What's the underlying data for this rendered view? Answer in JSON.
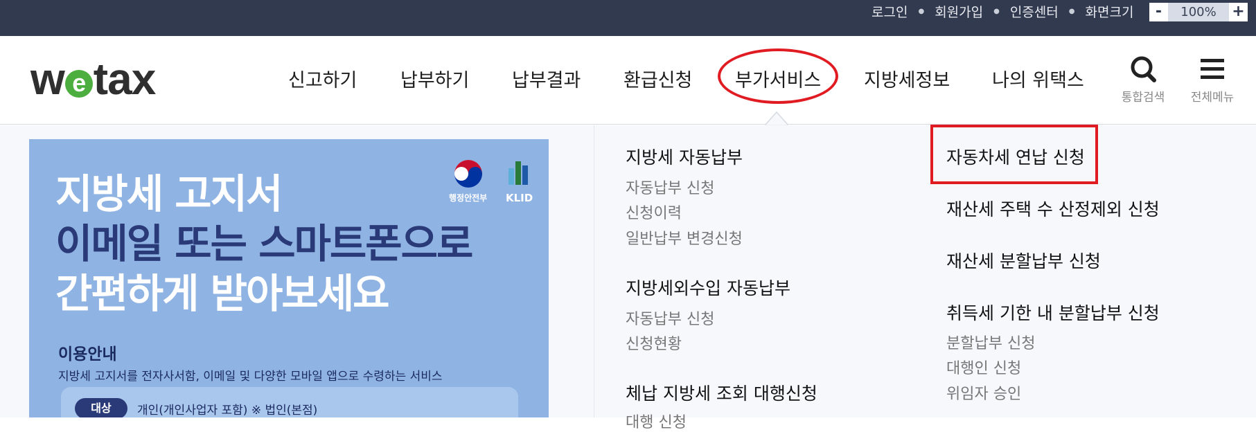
{
  "util_nav": {
    "login": "로그인",
    "join": "회원가입",
    "cert": "인증센터",
    "screen_size": "화면크기",
    "zoom_minus": "-",
    "zoom_value": "100%",
    "zoom_plus": "+"
  },
  "logo": {
    "w": "w",
    "e": "e",
    "tax": "tax"
  },
  "gnb": [
    "신고하기",
    "납부하기",
    "납부결과",
    "환급신청",
    "부가서비스",
    "지방세정보",
    "나의 위택스"
  ],
  "tools": {
    "search": "통합검색",
    "menu": "전체메뉴"
  },
  "banner": {
    "line1": "지방세 고지서",
    "line2a": "이메일 또는 ",
    "line2b": "스마트폰으로",
    "line3a": "간편하게 ",
    "line3b": "받아보세요",
    "org1": "행정안전부",
    "org2": "KLID",
    "label": "이용안내",
    "desc": "지방세 고지서를 전자사서함, 이메일 및 다양한 모바일 앱으로 수령하는 서비스",
    "tag": "대상",
    "tag_text": "개인(개인사업자 포함) ※ 법인(본점)"
  },
  "menu": {
    "col1": {
      "group1_title": "지방세 자동납부",
      "group1_items": [
        "자동납부 신청",
        "신청이력",
        "일반납부 변경신청"
      ],
      "group2_title": "지방세외수입 자동납부",
      "group2_items": [
        "자동납부 신청",
        "신청현황"
      ],
      "group3_title": "체납 지방세 조회 대행신청",
      "group3_items": [
        "대행 신청"
      ]
    },
    "col2": {
      "item1": "자동차세 연납 신청",
      "item2": "재산세 주택 수 산정제외 신청",
      "item3": "재산세 분할납부 신청",
      "group4_title": "취득세 기한 내 분할납부 신청",
      "group4_items": [
        "분할납부 신청",
        "대행인 신청",
        "위임자 승인"
      ]
    }
  },
  "colors": {
    "topbar": "#323a4f",
    "accent_red": "#e01b22",
    "logo_green": "#4cae3e",
    "banner_bg": "#8fb3e3",
    "banner_dark": "#2a3a78"
  }
}
